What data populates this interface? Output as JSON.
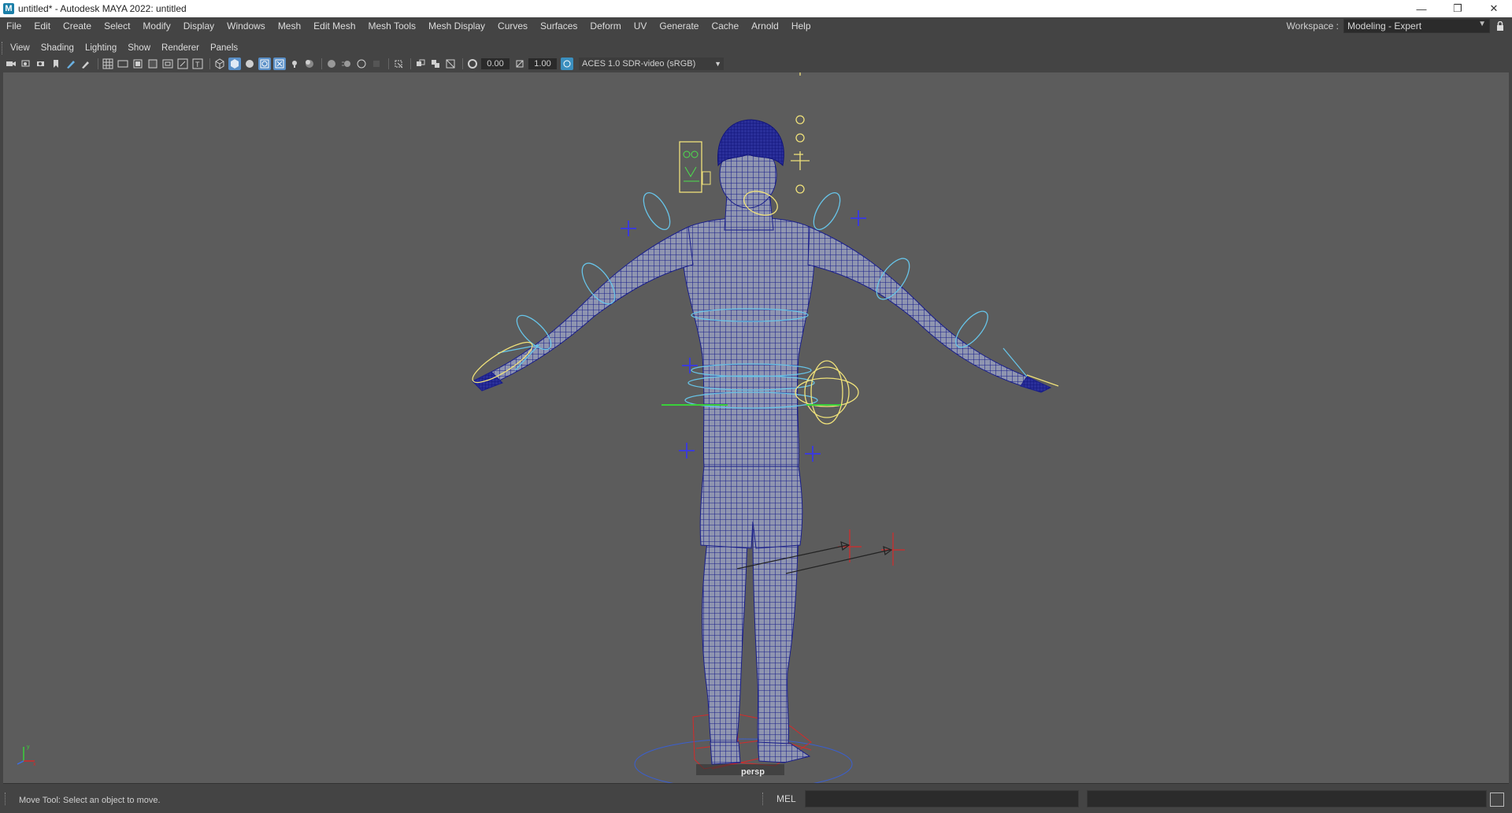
{
  "window": {
    "title": "untitled* - Autodesk MAYA 2022: untitled",
    "app_icon": "M",
    "minimize": "—",
    "maximize": "❐",
    "close": "✕"
  },
  "menubar": {
    "items": [
      "File",
      "Edit",
      "Create",
      "Select",
      "Modify",
      "Display",
      "Windows",
      "Mesh",
      "Edit Mesh",
      "Mesh Tools",
      "Mesh Display",
      "Curves",
      "Surfaces",
      "Deform",
      "UV",
      "Generate",
      "Cache",
      "Arnold",
      "Help"
    ]
  },
  "workspace": {
    "label": "Workspace :",
    "value": "Modeling - Expert"
  },
  "panel_menu": {
    "items": [
      "View",
      "Shading",
      "Lighting",
      "Show",
      "Renderer",
      "Panels"
    ]
  },
  "viewport_toolbar": {
    "exposure": "0.00",
    "gamma": "1.00",
    "color_space": "ACES 1.0 SDR-video (sRGB)",
    "icons": [
      "camera-icon",
      "camera-attributes-icon",
      "bookmark-icon",
      "image-plane-icon",
      "grease-pencil-icon",
      "grid-icon",
      "film-gate-icon",
      "resolution-gate-icon",
      "gate-mask-icon",
      "field-chart-icon",
      "safe-action-icon",
      "safe-title-icon",
      "wireframe-icon",
      "smooth-shade-icon",
      "default-material-icon",
      "xray-icon",
      "xray-joints-icon",
      "use-lights-icon",
      "shadows-icon",
      "screen-space-ao-icon",
      "motion-blur-icon",
      "multisample-aa-icon",
      "depth-of-field-icon",
      "isolate-select-icon",
      "wireframe-on-shaded-icon",
      "xray-active-icon",
      "backface-culling-icon"
    ]
  },
  "viewport": {
    "camera": "persp",
    "background": "#5c5c5c",
    "mesh_color": "#1a1f8a",
    "control_yellow": "#f0e27a",
    "control_cyan": "#67c4e8",
    "control_blue": "#3b3bd8",
    "locator_red": "#d42a2a"
  },
  "statusbar": {
    "help_line": "Move Tool: Select an object to move.",
    "mel_label": "MEL"
  }
}
